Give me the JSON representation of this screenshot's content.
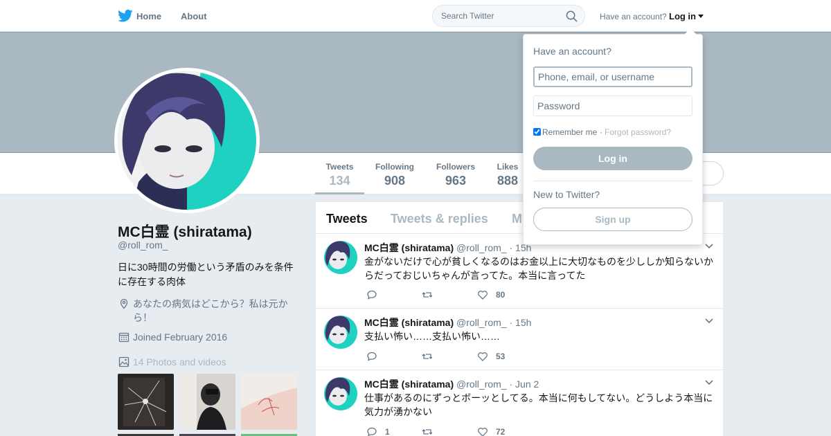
{
  "nav": {
    "home": "Home",
    "about": "About",
    "search_placeholder": "Search Twitter",
    "have_account": "Have an account?",
    "login": "Log in"
  },
  "profile": {
    "name": "MC白霊 (shiratama)",
    "handle": "@roll_rom_",
    "bio": "日に30時間の労働という矛盾のみを条件に存在する肉体",
    "location": "あなたの病気はどこから？私は元から！",
    "joined": "Joined February 2016",
    "photos": "14 Photos and videos"
  },
  "stats": [
    {
      "label": "Tweets",
      "value": "134"
    },
    {
      "label": "Following",
      "value": "908"
    },
    {
      "label": "Followers",
      "value": "963"
    },
    {
      "label": "Likes",
      "value": "888"
    }
  ],
  "tabs": [
    "Tweets",
    "Tweets & replies",
    "M"
  ],
  "tweets": [
    {
      "name": "MC白霊 (shiratama)",
      "handle": "@roll_rom_",
      "time": "· 15h",
      "text": "金がないだけで心が貧しくなるのはお金以上に大切なものを少ししか知らないからだっておじいちゃんが言ってた。本当に言ってた",
      "replies": "",
      "retweets": "",
      "likes": "80"
    },
    {
      "name": "MC白霊 (shiratama)",
      "handle": "@roll_rom_",
      "time": "· 15h",
      "text": "支払い怖い……支払い怖い……",
      "replies": "",
      "retweets": "",
      "likes": "53"
    },
    {
      "name": "MC白霊 (shiratama)",
      "handle": "@roll_rom_",
      "time": "· Jun 2",
      "text": "仕事があるのにずっとボーッとしてる。本当に何もしてない。どうしよう本当に気力が湧かない",
      "replies": "1",
      "retweets": "",
      "likes": "72"
    }
  ],
  "login_dropdown": {
    "title": "Have an account?",
    "username_placeholder": "Phone, email, or username",
    "password_placeholder": "Password",
    "remember": "Remember me",
    "separator": " · ",
    "forgot": "Forgot password?",
    "login_button": "Log in",
    "new_to": "New to Twitter?",
    "signup_button": "Sign up"
  },
  "colors": {
    "accent_disabled": "#aab8c2",
    "banner": "#aab8c2",
    "text_secondary": "#657786",
    "twitter_blue": "#1da1f2"
  }
}
